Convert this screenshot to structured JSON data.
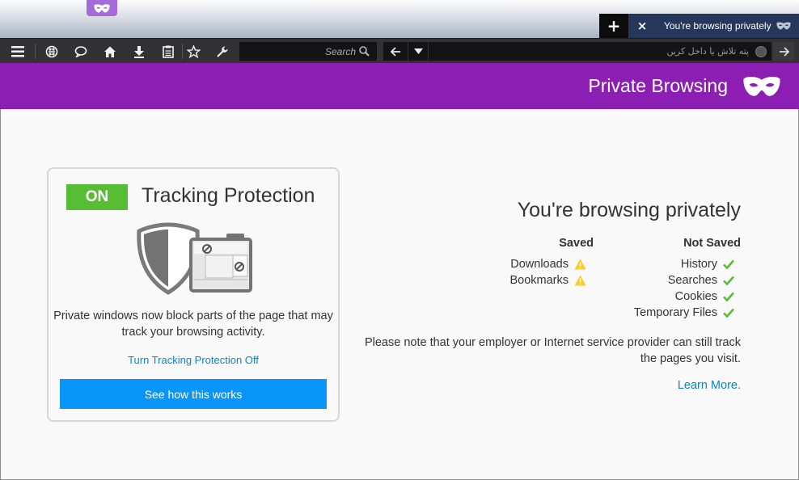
{
  "window": {
    "tab_title": "You're browsing privately",
    "new_tab_symbol": "+",
    "close_symbol": "×"
  },
  "toolbar": {
    "search_placeholder": "Search",
    "url_placeholder": "پته تلاش یا داخل کریں"
  },
  "header": {
    "title": "Private Browsing"
  },
  "tracking": {
    "status": "ON",
    "title": "Tracking Protection",
    "description": "Private windows now block parts of the page that may track your browsing activity.",
    "toggle_link": "Turn Tracking Protection Off",
    "button": "See how this works"
  },
  "private_info": {
    "title": "You're browsing privately",
    "saved_header": "Saved",
    "not_saved_header": "Not Saved",
    "saved": [
      "Downloads",
      "Bookmarks"
    ],
    "not_saved": [
      "History",
      "Searches",
      "Cookies",
      "Temporary Files"
    ],
    "note": "Please note that your employer or Internet service provider can still track the pages you visit.",
    "learn_more": "Learn More."
  },
  "colors": {
    "header_purple": "#8d1eb4",
    "badge_green": "#57bd35",
    "button_blue": "#0996f8",
    "link_blue": "#0a84c7",
    "warning_yellow": "#ffc82a",
    "check_green": "#57bd35"
  },
  "icons": {
    "toolbar": [
      "menu-icon",
      "addons-icon",
      "chat-icon",
      "home-icon",
      "download-icon",
      "reader-icon",
      "bookmark-star-icon",
      "wrench-icon"
    ],
    "saved_marker": "warning-icon",
    "not_saved_marker": "checkmark-icon"
  }
}
